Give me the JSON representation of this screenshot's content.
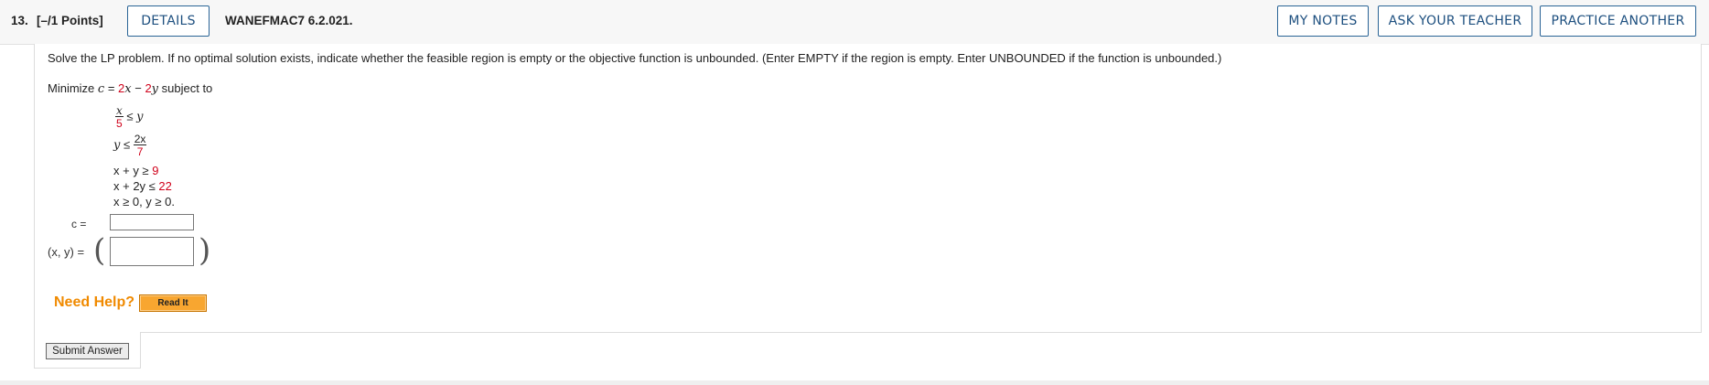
{
  "header": {
    "question_number": "13.",
    "points": "[–/1 Points]",
    "details_label": "DETAILS",
    "question_code": "WANEFMAC7 6.2.021.",
    "my_notes_label": "MY NOTES",
    "ask_teacher_label": "ASK YOUR TEACHER",
    "practice_another_label": "PRACTICE ANOTHER"
  },
  "problem": {
    "instructions": "Solve the LP problem. If no optimal solution exists, indicate whether the feasible region is empty or the objective function is unbounded. (Enter EMPTY if the region is empty. Enter UNBOUNDED if the function is unbounded.)",
    "minimize_prefix": "Minimize",
    "objective_var": "c",
    "objective_eq": " = ",
    "coef_x": "2",
    "x": "x",
    "minus": " − ",
    "coef_y": "2",
    "y": "y",
    "subject_to": " subject to",
    "c1": {
      "num": "x",
      "den": "5",
      "rel": " ≤ ",
      "rhs": "y"
    },
    "c2": {
      "lhs": "y",
      "rel": " ≤ ",
      "num": "2x",
      "den": "7"
    },
    "c3": {
      "lhs": "x + y ≥ ",
      "rhs": "9"
    },
    "c4": {
      "lhs": "x + 2y ≤ ",
      "rhs": "22"
    },
    "c5": "x ≥ 0, y ≥ 0."
  },
  "answers": {
    "c_label": "c =",
    "c_value": "",
    "xy_label": "(x, y) =",
    "xy_value": ""
  },
  "help": {
    "need_help": "Need Help?",
    "read_it": "Read It"
  },
  "submit_label": "Submit Answer",
  "colors": {
    "accent_blue": "#1d4f7f",
    "red_value": "#d0021b",
    "help_orange": "#f08a00",
    "read_it_bg": "#f8a630"
  }
}
